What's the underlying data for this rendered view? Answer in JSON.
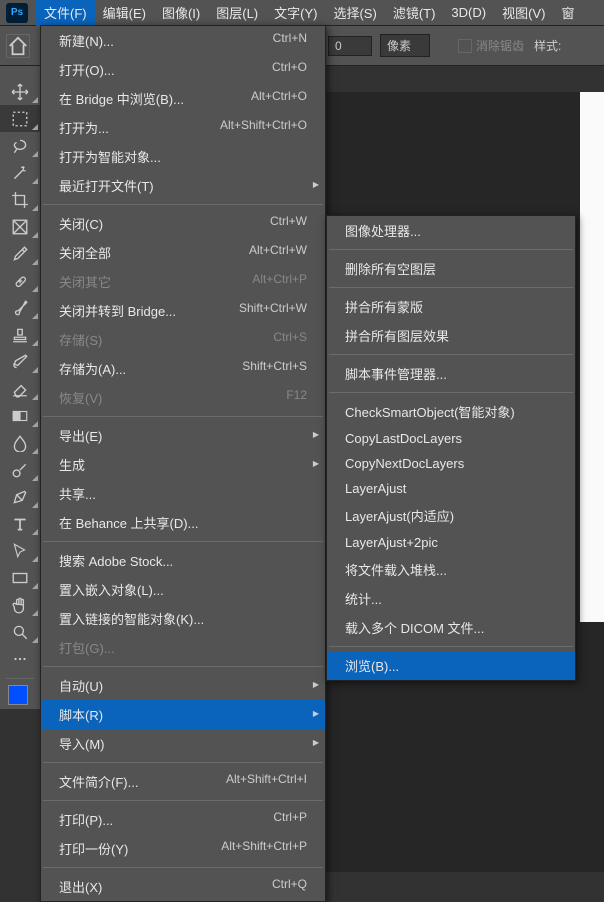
{
  "app_logo": "Ps",
  "menubar": [
    "文件(F)",
    "编辑(E)",
    "图像(I)",
    "图层(L)",
    "文字(Y)",
    "选择(S)",
    "滤镜(T)",
    "3D(D)",
    "视图(V)",
    "窗"
  ],
  "options": {
    "pixels": "像素",
    "antialias": "消除锯齿",
    "style": "样式:"
  },
  "file_menu": [
    {
      "label": "新建(N)...",
      "shortcut": "Ctrl+N"
    },
    {
      "label": "打开(O)...",
      "shortcut": "Ctrl+O"
    },
    {
      "label": "在 Bridge 中浏览(B)...",
      "shortcut": "Alt+Ctrl+O"
    },
    {
      "label": "打开为...",
      "shortcut": "Alt+Shift+Ctrl+O"
    },
    {
      "label": "打开为智能对象..."
    },
    {
      "label": "最近打开文件(T)",
      "sub": true
    },
    {
      "sep": true
    },
    {
      "label": "关闭(C)",
      "shortcut": "Ctrl+W"
    },
    {
      "label": "关闭全部",
      "shortcut": "Alt+Ctrl+W"
    },
    {
      "label": "关闭其它",
      "shortcut": "Alt+Ctrl+P",
      "disabled": true
    },
    {
      "label": "关闭并转到 Bridge...",
      "shortcut": "Shift+Ctrl+W"
    },
    {
      "label": "存储(S)",
      "shortcut": "Ctrl+S",
      "disabled": true
    },
    {
      "label": "存储为(A)...",
      "shortcut": "Shift+Ctrl+S"
    },
    {
      "label": "恢复(V)",
      "shortcut": "F12",
      "disabled": true
    },
    {
      "sep": true
    },
    {
      "label": "导出(E)",
      "sub": true
    },
    {
      "label": "生成",
      "sub": true
    },
    {
      "label": "共享..."
    },
    {
      "label": "在 Behance 上共享(D)..."
    },
    {
      "sep": true
    },
    {
      "label": "搜索 Adobe Stock..."
    },
    {
      "label": "置入嵌入对象(L)..."
    },
    {
      "label": "置入链接的智能对象(K)..."
    },
    {
      "label": "打包(G)...",
      "disabled": true
    },
    {
      "sep": true
    },
    {
      "label": "自动(U)",
      "sub": true
    },
    {
      "label": "脚本(R)",
      "sub": true,
      "highlight": true
    },
    {
      "label": "导入(M)",
      "sub": true
    },
    {
      "sep": true
    },
    {
      "label": "文件简介(F)...",
      "shortcut": "Alt+Shift+Ctrl+I"
    },
    {
      "sep": true
    },
    {
      "label": "打印(P)...",
      "shortcut": "Ctrl+P"
    },
    {
      "label": "打印一份(Y)",
      "shortcut": "Alt+Shift+Ctrl+P"
    },
    {
      "sep": true
    },
    {
      "label": "退出(X)",
      "shortcut": "Ctrl+Q"
    }
  ],
  "scripts_menu": [
    {
      "label": "图像处理器..."
    },
    {
      "sep": true
    },
    {
      "label": "删除所有空图层"
    },
    {
      "sep": true
    },
    {
      "label": "拼合所有蒙版"
    },
    {
      "label": "拼合所有图层效果"
    },
    {
      "sep": true
    },
    {
      "label": "脚本事件管理器..."
    },
    {
      "sep": true
    },
    {
      "label": "CheckSmartObject(智能对象)"
    },
    {
      "label": "CopyLastDocLayers"
    },
    {
      "label": "CopyNextDocLayers"
    },
    {
      "label": "LayerAjust"
    },
    {
      "label": "LayerAjust(内适应)"
    },
    {
      "label": "LayerAjust+2pic"
    },
    {
      "label": "将文件载入堆栈..."
    },
    {
      "label": "统计..."
    },
    {
      "label": "载入多个 DICOM 文件..."
    },
    {
      "sep": true
    },
    {
      "label": "浏览(B)...",
      "highlight": true
    }
  ],
  "tools": [
    "move",
    "marquee",
    "lasso",
    "wand",
    "crop",
    "frame",
    "eyedropper",
    "heal",
    "brush",
    "stamp",
    "history",
    "eraser",
    "gradient",
    "blur",
    "dodge",
    "pen",
    "type",
    "path",
    "rect",
    "hand",
    "zoom"
  ],
  "swatch_color": "#0050ff",
  "field_zero": "0"
}
